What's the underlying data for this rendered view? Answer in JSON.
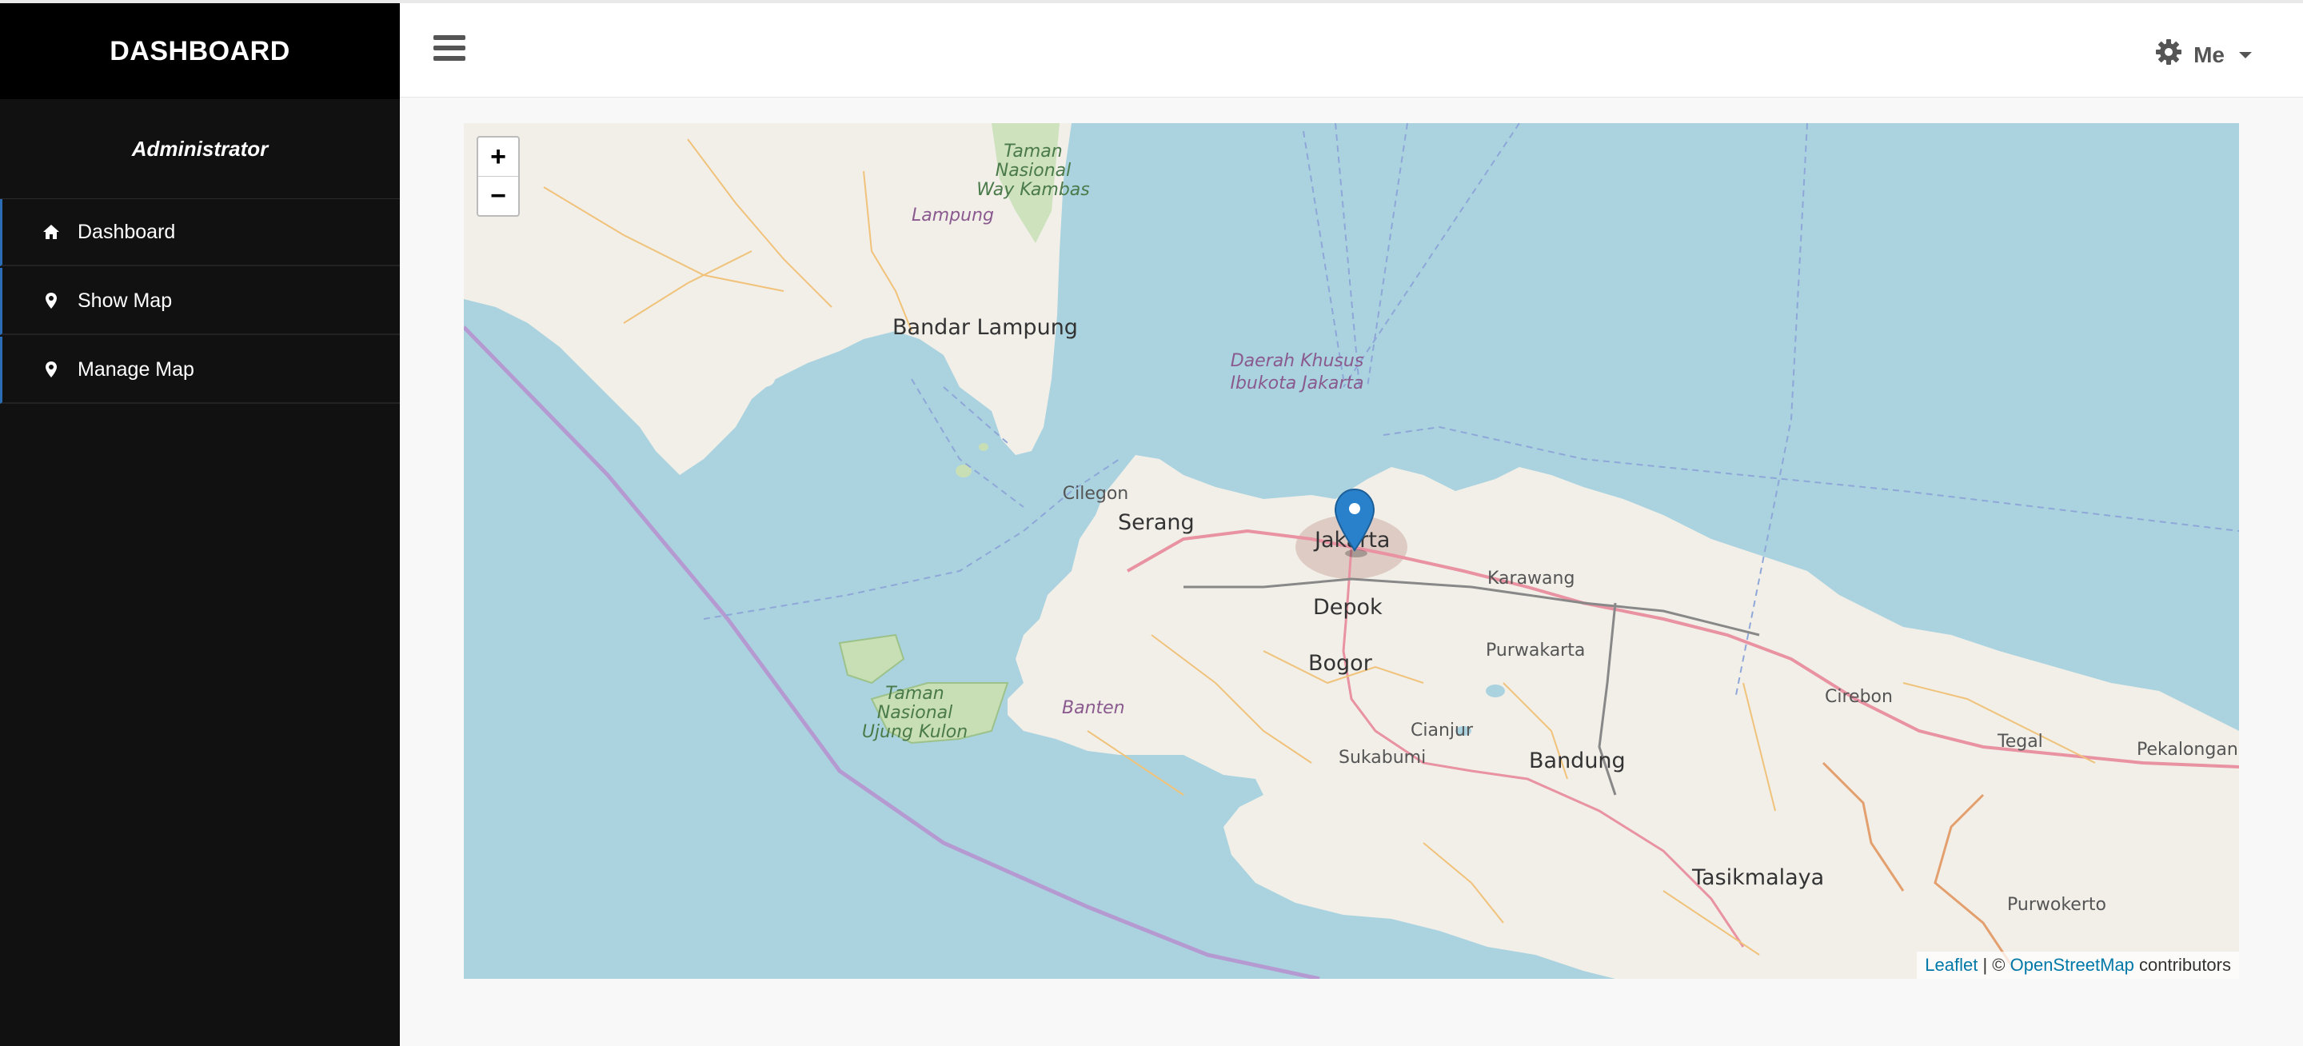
{
  "sidebar": {
    "brand": "DASHBOARD",
    "role": "Administrator",
    "items": [
      {
        "label": "Dashboard",
        "icon": "home-icon"
      },
      {
        "label": "Show Map",
        "icon": "map-marker-icon"
      },
      {
        "label": "Manage Map",
        "icon": "map-marker-icon"
      }
    ]
  },
  "topbar": {
    "user_label": "Me",
    "user_icon": "gear-icon",
    "menu_icon": "hamburger-icon"
  },
  "map": {
    "zoom_in": "+",
    "zoom_out": "−",
    "labels": {
      "taman_way_kambas": [
        "Taman",
        "Nasional",
        "Way Kambas"
      ],
      "lampung": "Lampung",
      "bandar_lampung": "Bandar Lampung",
      "dki": [
        "Daerah Khusus",
        "Ibukota Jakarta"
      ],
      "cilegon": "Cilegon",
      "serang": "Serang",
      "jakarta": "Jakarta",
      "karawang": "Karawang",
      "depok": "Depok",
      "bogor": "Bogor",
      "purwakarta": "Purwakarta",
      "cirebon": "Cirebon",
      "banten": "Banten",
      "taman_ujung_kulon": [
        "Taman",
        "Nasional",
        "Ujung Kulon"
      ],
      "cianjur": "Cianjur",
      "sukabumi": "Sukabumi",
      "bandung": "Bandung",
      "tegal": "Tegal",
      "pekalongan": "Pekalongan",
      "tasikmalaya": "Tasikmalaya",
      "purwokerto": "Purwokerto"
    },
    "attribution": {
      "leaflet": "Leaflet",
      "separator": "| ©",
      "osm": "OpenStreetMap",
      "suffix": "contributors"
    }
  },
  "colors": {
    "sidebar_bg": "#111111",
    "brand_bg": "#000000",
    "accent": "#2a6db5",
    "water": "#aad3df",
    "land": "#f2efe9",
    "marker": "#2a81cb"
  }
}
